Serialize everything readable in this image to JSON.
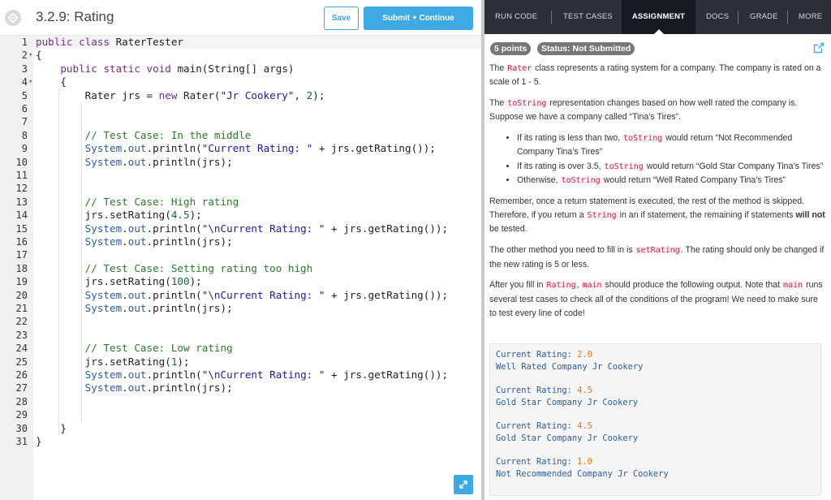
{
  "header": {
    "title": "3.2.9: Rating",
    "save_label": "Save",
    "submit_label": "Submit + Continue"
  },
  "editor": {
    "line_numbers": [
      "1",
      "2",
      "3",
      "4",
      "5",
      "6",
      "7",
      "8",
      "9",
      "10",
      "11",
      "12",
      "13",
      "14",
      "15",
      "16",
      "17",
      "18",
      "19",
      "20",
      "21",
      "22",
      "23",
      "24",
      "25",
      "26",
      "27",
      "28",
      "29",
      "30",
      "31"
    ],
    "lines": [
      "public class RaterTester",
      "{",
      "    public static void main(String[] args)",
      "    {",
      "        Rater jrs = new Rater(\"Jr Cookery\", 2);",
      "",
      "",
      "        // Test Case: In the middle",
      "        System.out.println(\"Current Rating: \" + jrs.getRating());",
      "        System.out.println(jrs);",
      "",
      "",
      "        // Test Case: High rating",
      "        jrs.setRating(4.5);",
      "        System.out.println(\"\\nCurrent Rating: \" + jrs.getRating());",
      "        System.out.println(jrs);",
      "",
      "        // Test Case: Setting rating too high",
      "        jrs.setRating(100);",
      "        System.out.println(\"\\nCurrent Rating: \" + jrs.getRating());",
      "        System.out.println(jrs);",
      "",
      "",
      "        // Test Case: Low rating",
      "        jrs.setRating(1);",
      "        System.out.println(\"\\nCurrent Rating: \" + jrs.getRating());",
      "        System.out.println(jrs);",
      "",
      "",
      "    }",
      "}"
    ]
  },
  "tabs": [
    {
      "label": "RUN CODE"
    },
    {
      "label": "TEST CASES"
    },
    {
      "label": "ASSIGNMENT"
    },
    {
      "label": "DOCS"
    },
    {
      "label": "GRADE"
    },
    {
      "label": "MORE"
    }
  ],
  "badges": {
    "points": "5 points",
    "status": "Status: Not Submitted"
  },
  "assignment": {
    "p1_a": "The ",
    "p1_code": "Rater",
    "p1_b": " class represents a rating system for a company. The company is rated on a scale of 1 - 5.",
    "p2_a": "The ",
    "p2_code": "toString",
    "p2_b": " representation changes based on how well rated the company is. Suppose we have a company called “Tina’s Tires”.",
    "b1_a": "If its rating is less than two, ",
    "b1_code": "toString",
    "b1_b": " would return “Not Recommended Company Tina’s Tires”",
    "b2_a": "If its rating is over 3.5, ",
    "b2_code": "toString",
    "b2_b": " would return “Gold Star Company Tina’s Tires”",
    "b3_a": "Otherwise, ",
    "b3_code": "toString",
    "b3_b": " would return “Well Rated Company Tina’s Tires”",
    "p3_a": "Remember, once a return statement is executed, the rest of the method is skipped. Therefore, if you return a ",
    "p3_code": "String",
    "p3_b": " in an if statement, the remaining if statements ",
    "p3_bold": "will not",
    "p3_c": " be tested.",
    "p4_a": "The other method you need to fill in is ",
    "p4_code": "setRating",
    "p4_b": ". The rating should only be changed if the new rating is 5 or less.",
    "p5_a": "After you fill in ",
    "p5_code1": "Rating",
    "p5_sep": ", ",
    "p5_code2": "main",
    "p5_b": " should produce the following output. Note that ",
    "p5_code3": "main",
    "p5_c": " runs several test cases to check all of the conditions of the program! We need to make sure to test every line of code!"
  },
  "output": [
    {
      "label": "Current Rating: ",
      "value": "2.0",
      "line2": "Well Rated Company Jr Cookery"
    },
    {
      "label": "Current Rating: ",
      "value": "4.5",
      "line2": "Gold Star Company Jr Cookery"
    },
    {
      "label": "Current Rating: ",
      "value": "4.5",
      "line2": "Gold Star Company Jr Cookery"
    },
    {
      "label": "Current Rating: ",
      "value": "1.0",
      "line2": "Not Recommended Company Jr Cookery"
    }
  ],
  "colors": {
    "accent": "#3fa9e3",
    "tab_bar": "#2b3038",
    "badge": "#777777",
    "inline_code": "#c7254e"
  },
  "icons": {
    "settings": "gear-icon",
    "expand": "expand-icon",
    "external": "external-link-icon"
  }
}
